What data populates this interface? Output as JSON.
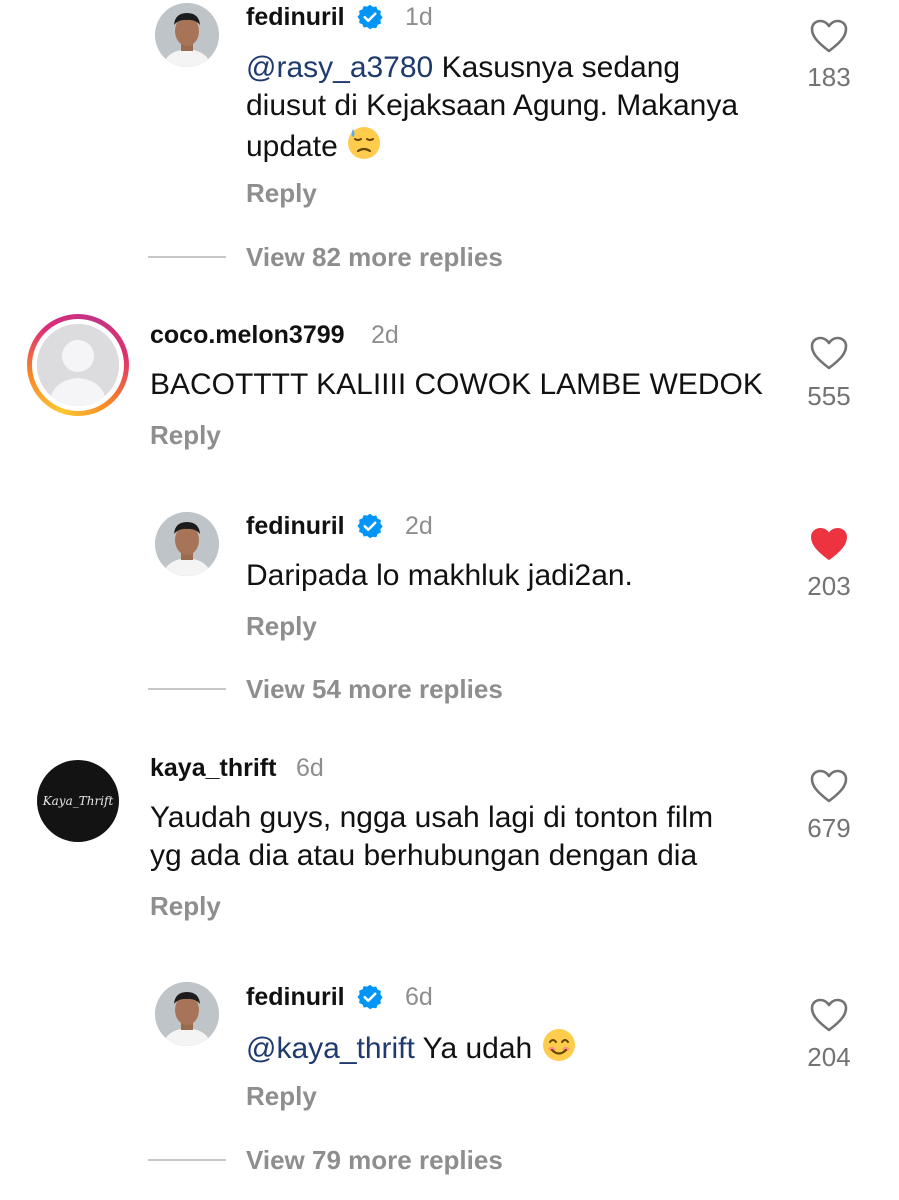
{
  "comments": [
    {
      "username": "fedinuril",
      "verified": true,
      "time": "1d",
      "mention": "@rasy_a3780",
      "lines": [
        "Kasusnya sedang",
        "diusut di Kejaksaan Agung. Makanya",
        "update"
      ],
      "emoji": "downcast-face-with-sweat",
      "reply_label": "Reply",
      "likes": "183",
      "liked": false,
      "view_replies": "View 82 more replies"
    },
    {
      "username": "coco.melon3799",
      "time": "2d",
      "text": "BACOTTTT KALIIII COWOK LAMBE WEDOK",
      "reply_label": "Reply",
      "likes": "555",
      "liked": false
    },
    {
      "username": "fedinuril",
      "verified": true,
      "time": "2d",
      "text": "Daripada lo makhluk jadi2an.",
      "reply_label": "Reply",
      "likes": "203",
      "liked": true,
      "like_color": "#ed3340",
      "view_replies": "View 54 more replies"
    },
    {
      "username": "kaya_thrift",
      "avatar_text": "Kaya_Thrift",
      "time": "6d",
      "lines": [
        "Yaudah guys, ngga usah lagi di tonton film",
        "yg ada dia atau berhubungan dengan dia"
      ],
      "reply_label": "Reply",
      "likes": "679",
      "liked": false
    },
    {
      "username": "fedinuril",
      "verified": true,
      "time": "6d",
      "mention": "@kaya_thrift",
      "text": "Ya udah",
      "emoji": "smiling-face",
      "reply_label": "Reply",
      "likes": "204",
      "liked": false,
      "view_replies": "View 79 more replies"
    }
  ],
  "colors": {
    "verified_badge": "#0095f6",
    "mention": "#1f3a6e",
    "secondary_text": "#8e8e8e",
    "liked_heart": "#ed3340"
  }
}
